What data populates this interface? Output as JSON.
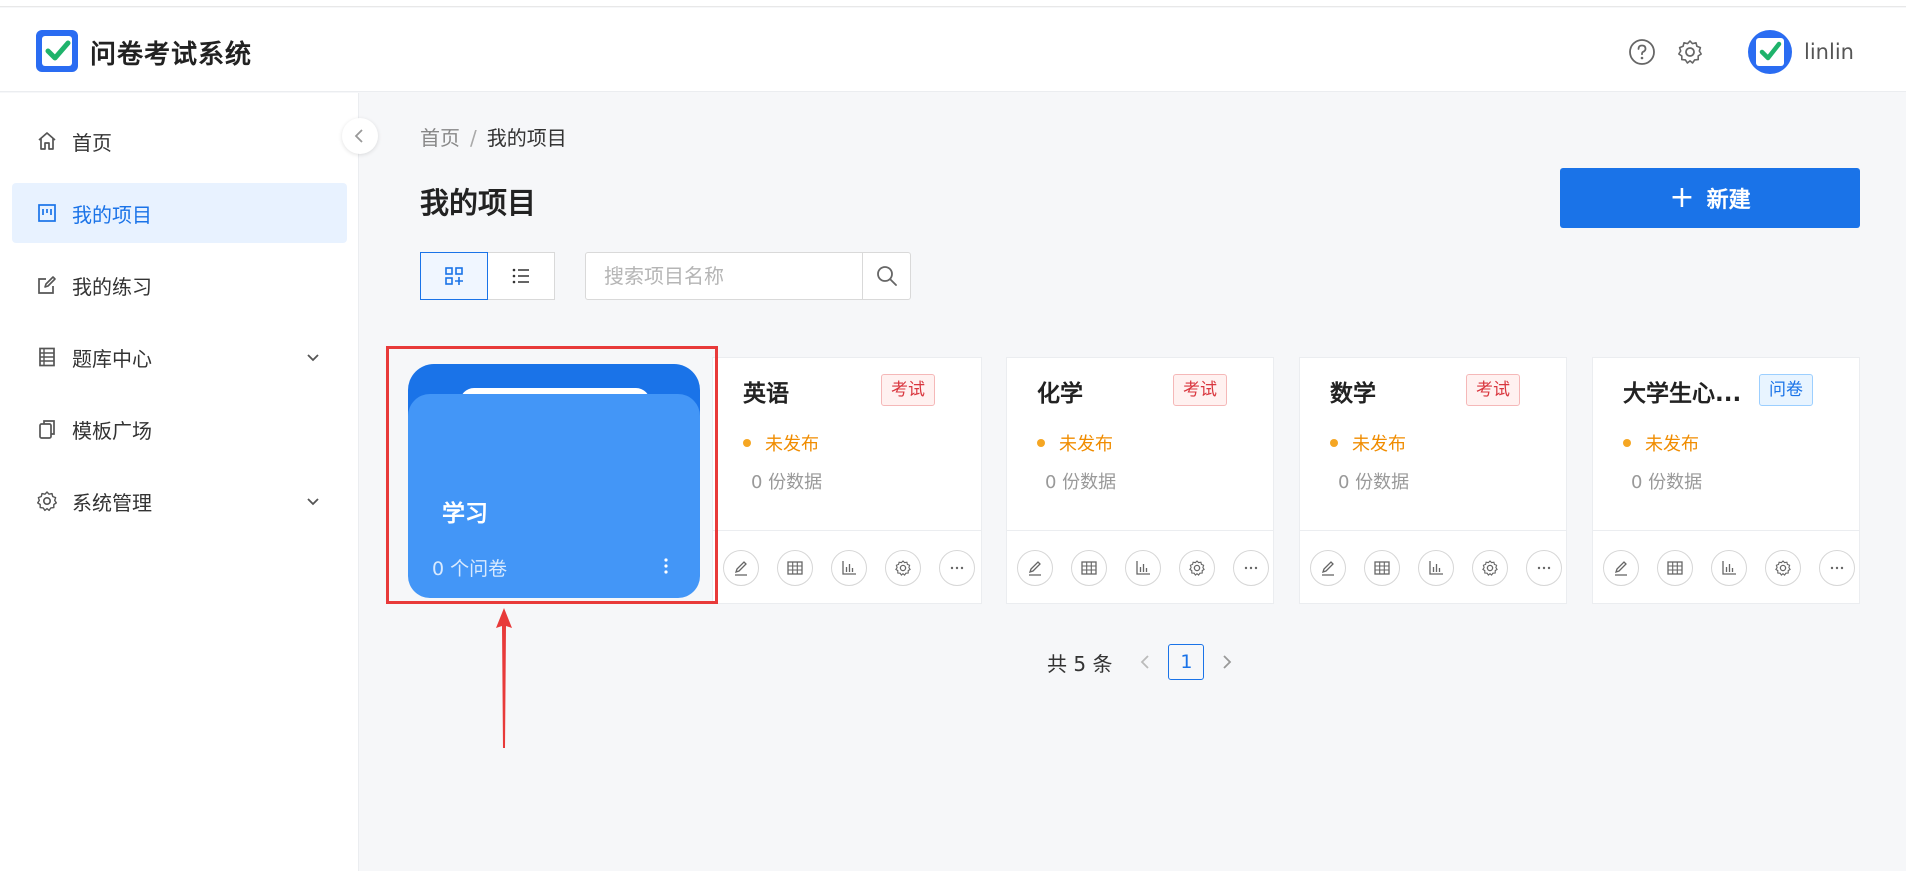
{
  "app": {
    "title": "问卷考试系统"
  },
  "user": {
    "name": "linlin"
  },
  "sidebar": {
    "items": [
      {
        "label": "首页",
        "icon": "home-icon"
      },
      {
        "label": "我的项目",
        "icon": "project-icon",
        "active": true
      },
      {
        "label": "我的练习",
        "icon": "edit-icon"
      },
      {
        "label": "题库中心",
        "icon": "book-icon",
        "expandable": true
      },
      {
        "label": "模板广场",
        "icon": "copy-icon"
      },
      {
        "label": "系统管理",
        "icon": "gear-icon",
        "expandable": true
      }
    ]
  },
  "breadcrumb": {
    "home": "首页",
    "separator": "/",
    "current": "我的项目"
  },
  "page": {
    "title": "我的项目"
  },
  "toolbar": {
    "new_label": "新建",
    "search_placeholder": "搜索项目名称"
  },
  "folder": {
    "name": "学习",
    "count_text": "0 个问卷"
  },
  "projects": [
    {
      "name": "英语",
      "tag": "考试",
      "status": "未发布",
      "data_count": "0 份数据"
    },
    {
      "name": "化学",
      "tag": "考试",
      "status": "未发布",
      "data_count": "0 份数据"
    },
    {
      "name": "数学",
      "tag": "考试",
      "status": "未发布",
      "data_count": "0 份数据"
    },
    {
      "name": "大学生心...",
      "tag": "问卷",
      "status": "未发布",
      "data_count": "0 份数据"
    }
  ],
  "pagination": {
    "total_text": "共 5 条",
    "current_page": "1"
  },
  "colors": {
    "primary": "#1a73e8",
    "folder": "#4396f7",
    "warning": "#f08c00",
    "danger": "#d9363e",
    "highlight": "#e83a3a"
  }
}
